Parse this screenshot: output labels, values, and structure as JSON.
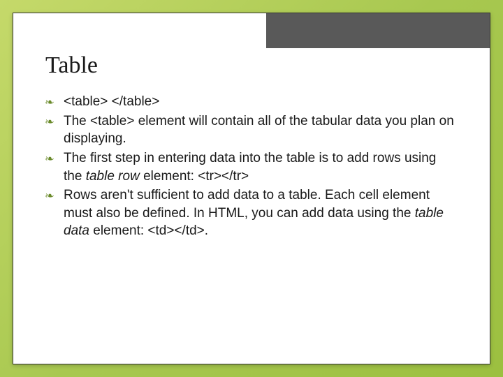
{
  "title": "Table",
  "bullets": {
    "b1": "<table> </table>",
    "b2_part1": "The <table> element will contain all of the tabular data you plan on displaying.",
    "b3_part1": "The first step in entering data into the table is to add rows using the ",
    "b3_italic1": "table row",
    "b3_part2": " element: <tr></tr>",
    "b4_part1": "Rows aren't sufficient to add data to a table. Each cell element must also be defined. In HTML, you can add data using the ",
    "b4_italic1": "table data",
    "b4_part2": " element: <td></td>."
  },
  "bullet_glyph": "❧"
}
